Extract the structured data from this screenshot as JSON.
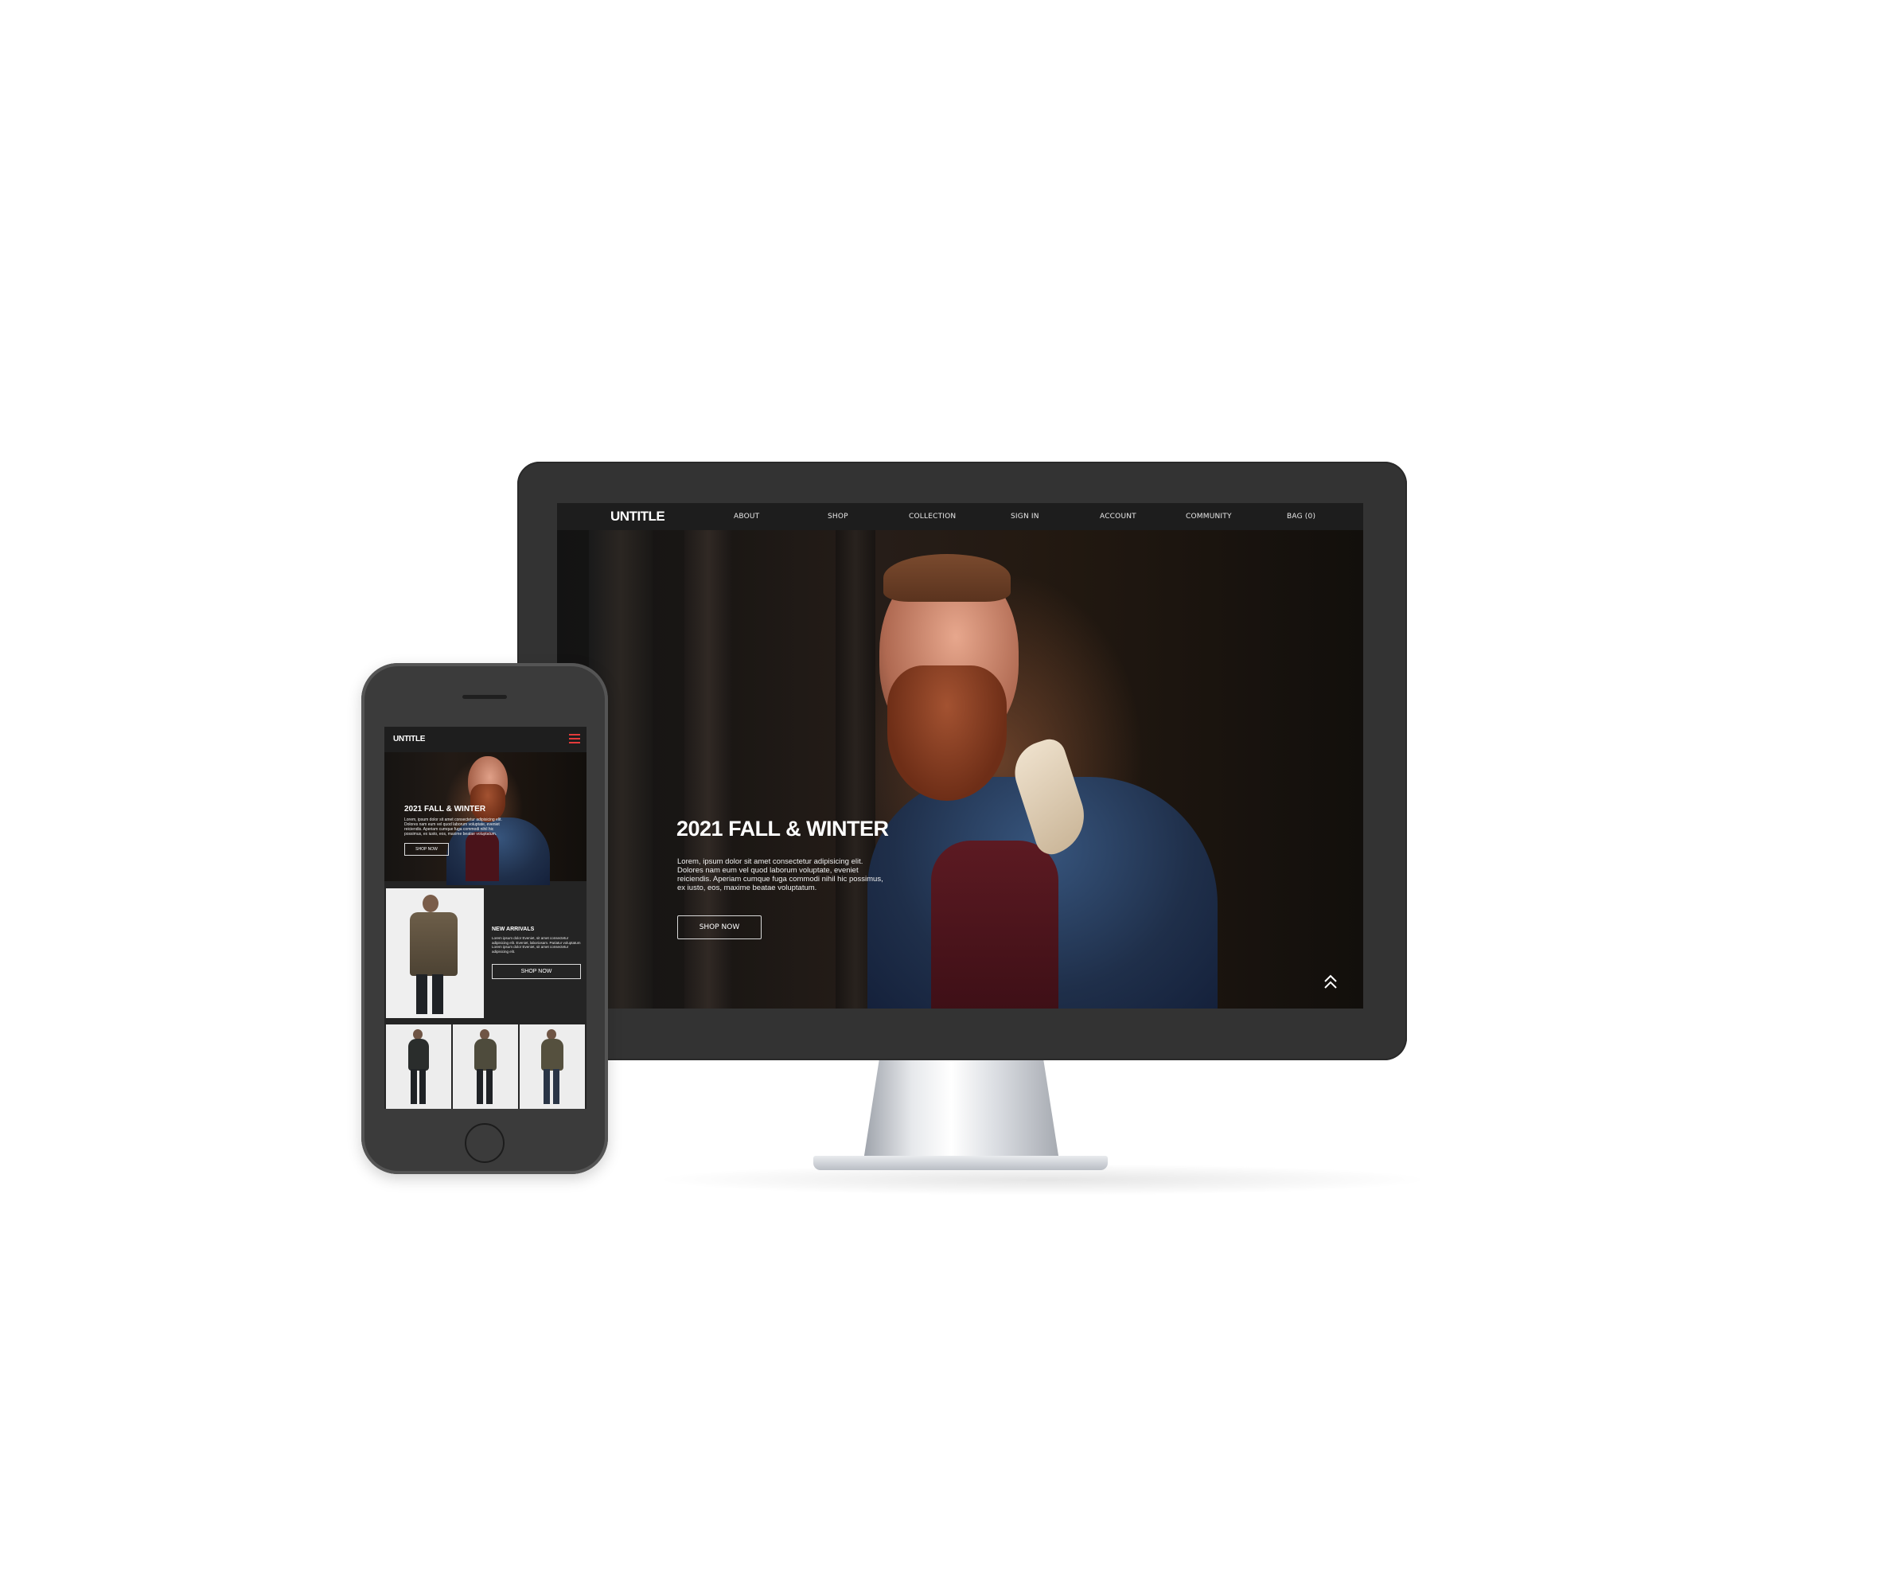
{
  "desktop": {
    "nav": {
      "logo": "UNTITLE",
      "items": [
        {
          "label": "ABOUT"
        },
        {
          "label": "SHOP"
        },
        {
          "label": "COLLECTION"
        },
        {
          "label": "SIGN IN"
        },
        {
          "label": "ACCOUNT"
        },
        {
          "label": "COMMUNITY"
        },
        {
          "label": "BAG (0)"
        }
      ]
    },
    "hero": {
      "title": "2021 FALL & WINTER",
      "text": "Lorem, ipsum dolor sit amet consectetur adipisicing elit. Dolores nam eum vel quod laborum voluptate, eveniet reiciendis. Aperiam cumque fuga commodi nihil hic possimus, ex iusto, eos, maxime beatae voluptatum.",
      "button": "SHOP NOW"
    }
  },
  "mobile": {
    "nav": {
      "logo": "UNTITLE"
    },
    "hero": {
      "title": "2021 FALL & WINTER",
      "text": "Lorem, ipsum dolor sit amet consectetur adipisicing elit. Dolores nam eum vel quod laborum voluptate, eveniet reiciendis. Aperiam cumque fuga commodi nihil hic possimus, ex iusto, eos, maxime beatae voluptatum.",
      "button": "SHOP NOW"
    },
    "new_arrivals": {
      "title": "NEW ARRIVALS",
      "text": "Lorem ipsum dolor Eveniet, sit amet consectetur adipisicing elit. Eveniet, laboriosam. Pariatur voluptatum Lorem ipsum dolor Eveniet, sit amet consectetur adipisicing elit.",
      "button": "SHOP NOW"
    }
  },
  "colors": {
    "page_bg": "#ffffff",
    "device_body": "#333333",
    "nav_bg": "#1d1d1d",
    "menu_accent": "#e33b3b"
  }
}
